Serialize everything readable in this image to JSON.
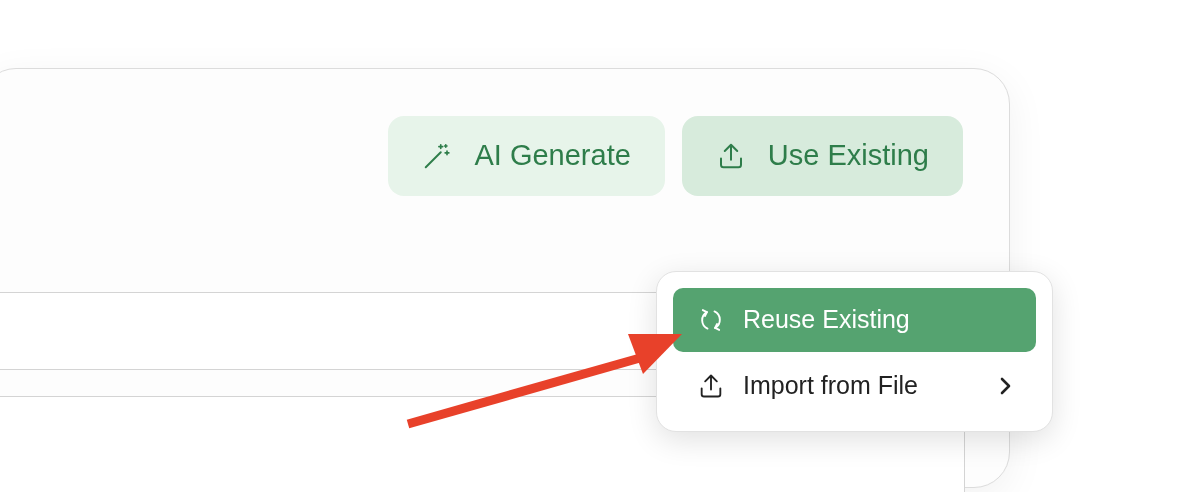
{
  "toolbar": {
    "buttons": [
      {
        "label": "AI Generate",
        "kind": "wand",
        "selected": false
      },
      {
        "label": "Use Existing",
        "kind": "upload",
        "selected": true
      }
    ]
  },
  "menu": {
    "items": [
      {
        "label": "Reuse Existing",
        "kind": "refresh",
        "selected": true,
        "submenu": false
      },
      {
        "label": "Import from File",
        "kind": "upload",
        "selected": false,
        "submenu": true
      }
    ]
  },
  "annotation": {
    "kind": "arrow"
  }
}
